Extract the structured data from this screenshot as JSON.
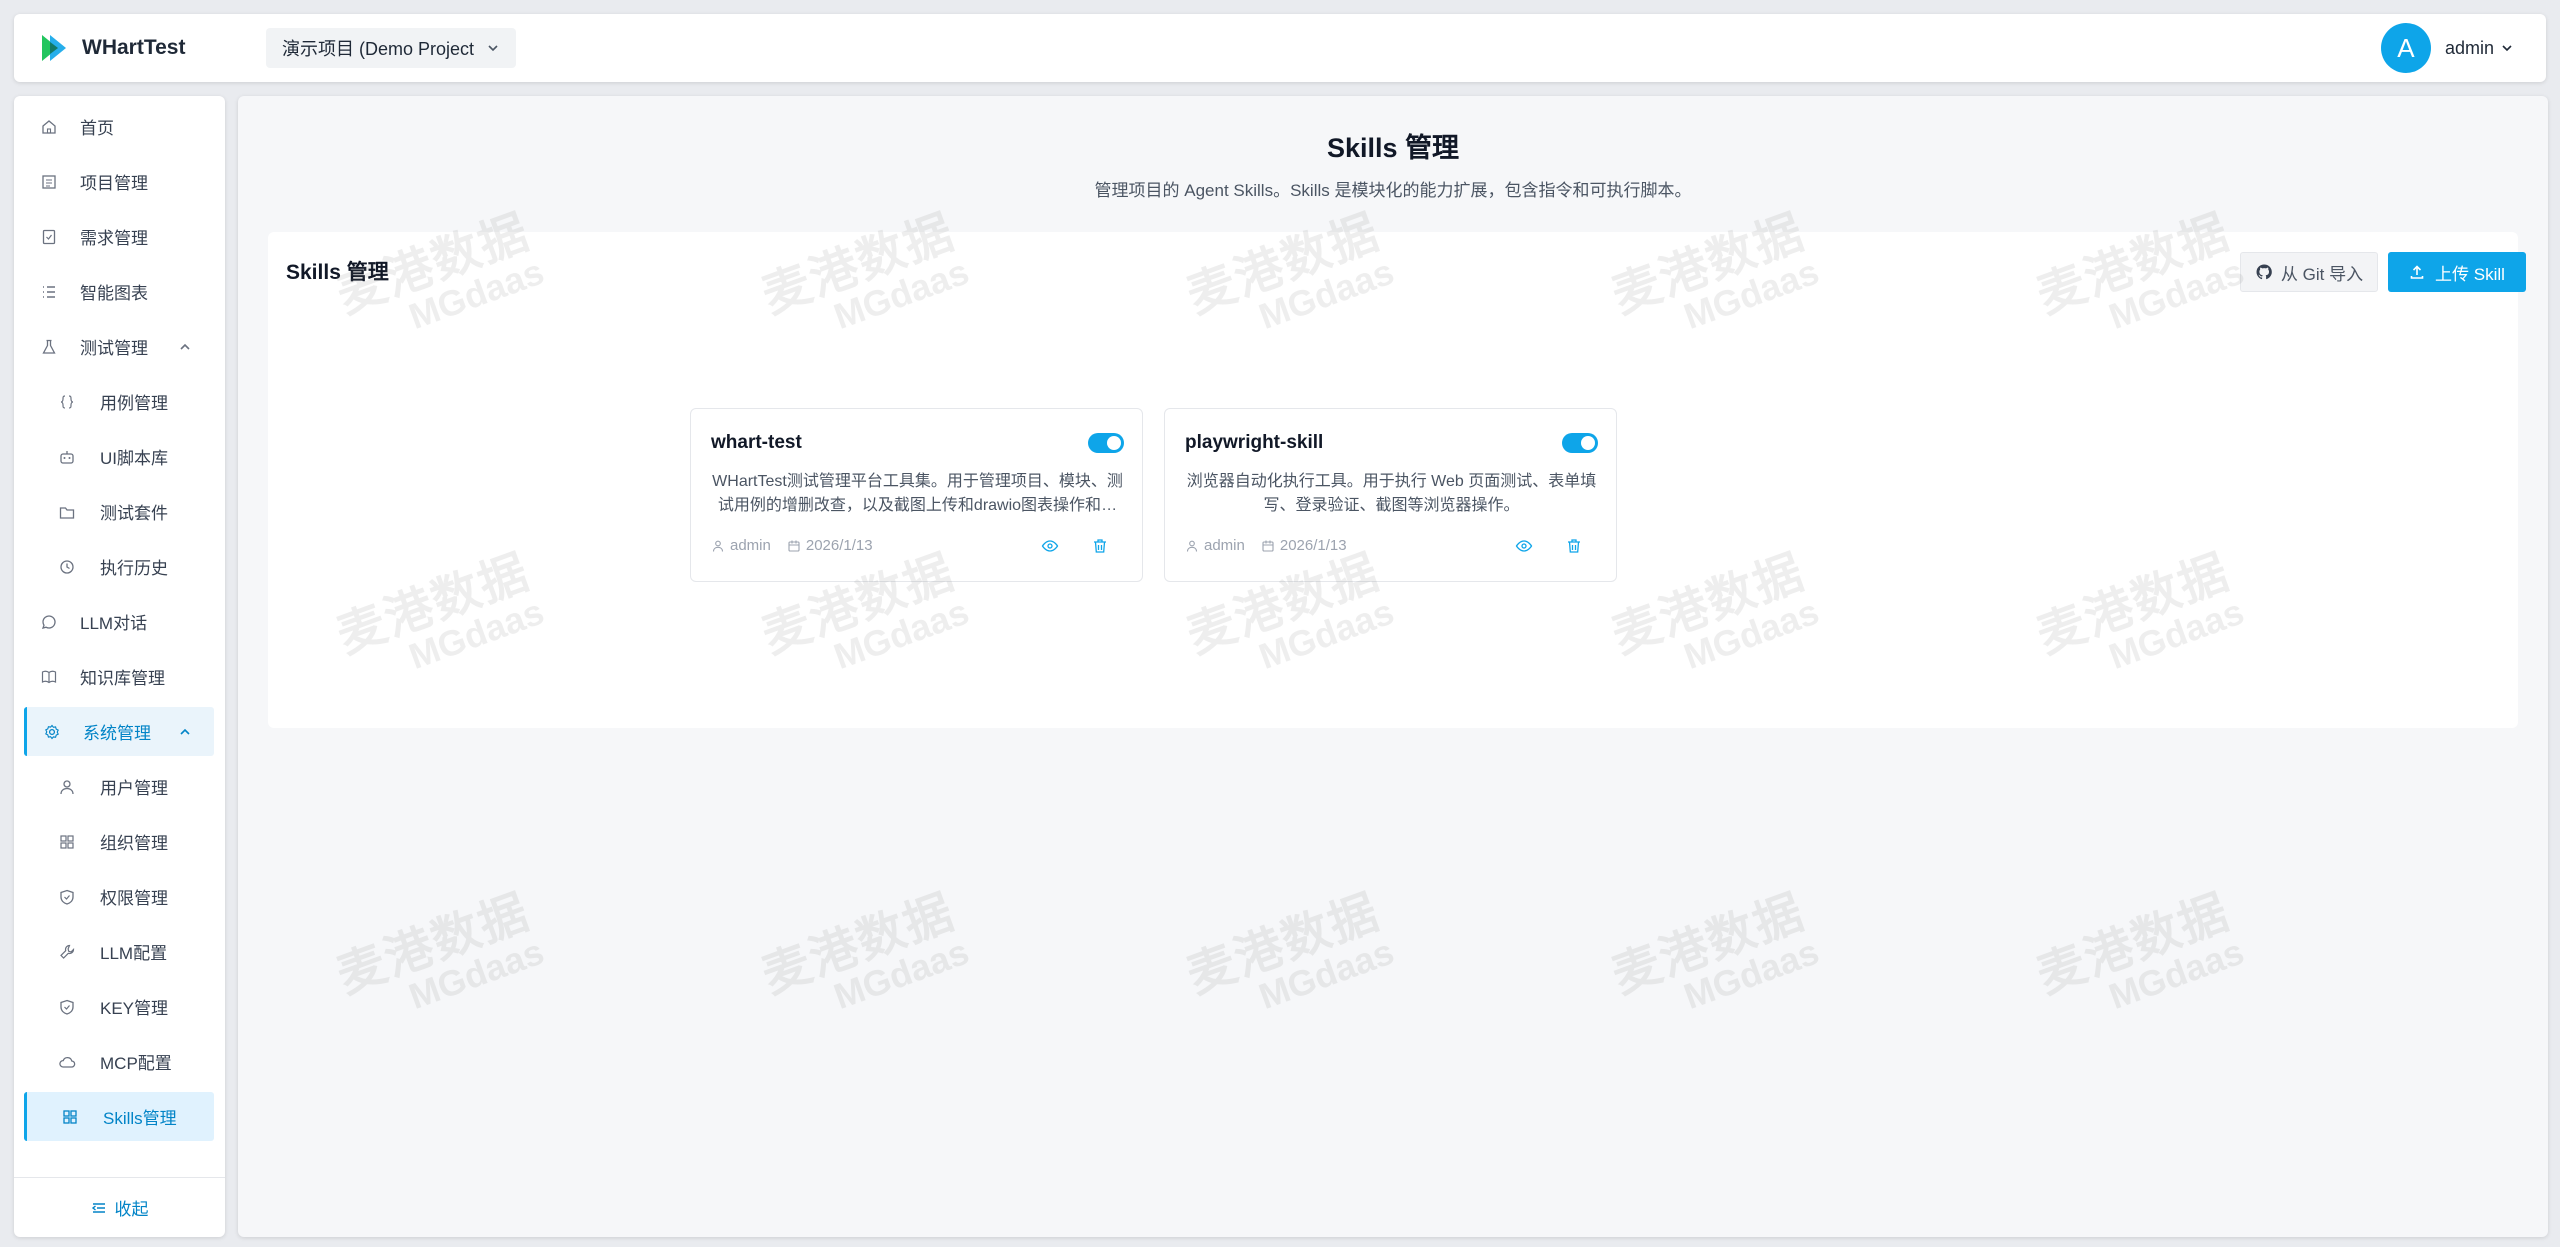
{
  "app": {
    "name": "WHartTest"
  },
  "header": {
    "project": "演示项目 (Demo Project",
    "user_initial": "A",
    "user_name": "admin"
  },
  "sidebar": {
    "items": [
      {
        "label": "首页",
        "icon": "home-icon"
      },
      {
        "label": "项目管理",
        "icon": "project-icon"
      },
      {
        "label": "需求管理",
        "icon": "requirement-icon"
      },
      {
        "label": "智能图表",
        "icon": "list-icon"
      },
      {
        "label": "测试管理",
        "icon": "flask-icon",
        "expanded": true
      },
      {
        "label": "用例管理",
        "icon": "braces-icon"
      },
      {
        "label": "UI脚本库",
        "icon": "robot-icon"
      },
      {
        "label": "测试套件",
        "icon": "folder-icon"
      },
      {
        "label": "执行历史",
        "icon": "history-icon"
      },
      {
        "label": "LLM对话",
        "icon": "chat-icon"
      },
      {
        "label": "知识库管理",
        "icon": "book-icon"
      },
      {
        "label": "系统管理",
        "icon": "gear-icon",
        "expanded": true
      },
      {
        "label": "用户管理",
        "icon": "user-icon"
      },
      {
        "label": "组织管理",
        "icon": "grid-icon"
      },
      {
        "label": "权限管理",
        "icon": "shield-icon"
      },
      {
        "label": "LLM配置",
        "icon": "wrench-icon"
      },
      {
        "label": "KEY管理",
        "icon": "key-shield-icon"
      },
      {
        "label": "MCP配置",
        "icon": "cloud-icon"
      },
      {
        "label": "Skills管理",
        "icon": "apps-icon",
        "active": true
      }
    ],
    "collapse_label": "收起"
  },
  "main": {
    "title": "Skills 管理",
    "subtitle": "管理项目的 Agent Skills。Skills 是模块化的能力扩展，包含指令和可执行脚本。",
    "panel_title": "Skills 管理",
    "git_import_label": "从 Git 导入",
    "upload_label": "上传 Skill",
    "skills": [
      {
        "name": "whart-test",
        "enabled": true,
        "description": "WHartTest测试管理平台工具集。用于管理项目、模块、测试用例的增删改查，以及截图上传和drawio图表操作和测试执行等功能。",
        "author": "admin",
        "date": "2026/1/13"
      },
      {
        "name": "playwright-skill",
        "enabled": true,
        "description": "浏览器自动化执行工具。用于执行 Web 页面测试、表单填写、登录验证、截图等浏览器操作。",
        "author": "admin",
        "date": "2026/1/13"
      }
    ]
  },
  "watermark": {
    "line1": "麦港数据",
    "line2": "MGdaas"
  },
  "colors": {
    "accent": "#0ea5e9",
    "active_bg": "#e0f2fe"
  }
}
